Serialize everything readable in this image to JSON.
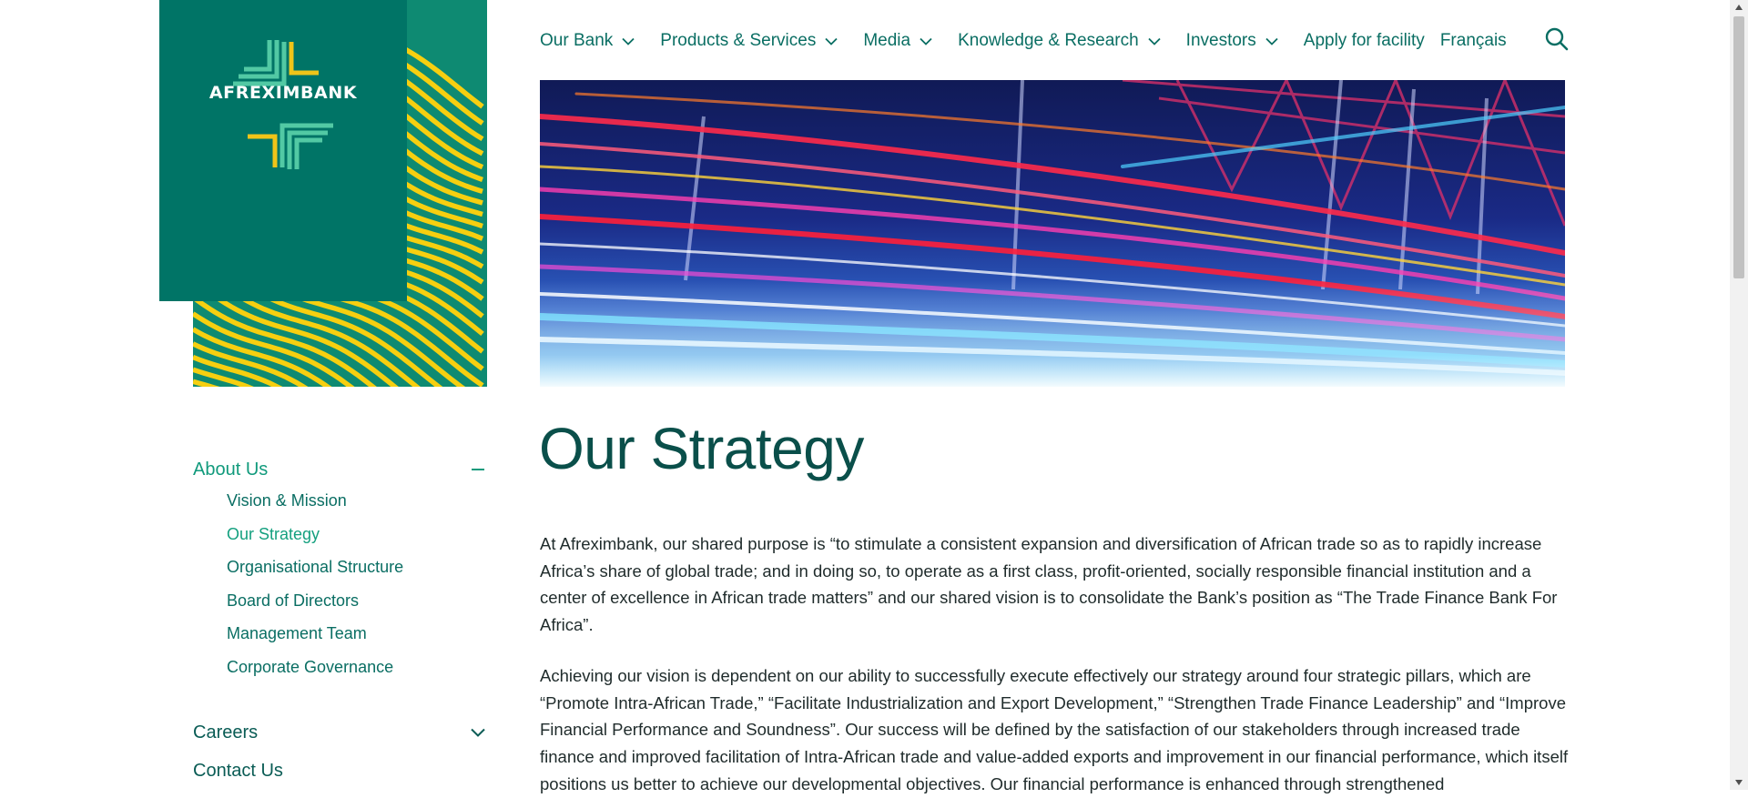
{
  "brand": {
    "name": "AFREXIMBANK",
    "colors": {
      "teal": "#007466",
      "stripe_green": "#0e8a72",
      "stripe_yellow": "#f6cf10",
      "logo_light": "#52c9a4",
      "logo_yellow": "#f0c419"
    }
  },
  "nav": {
    "items": [
      {
        "label": "Our Bank",
        "has_dropdown": true
      },
      {
        "label": "Products & Services",
        "has_dropdown": true
      },
      {
        "label": "Media",
        "has_dropdown": true
      },
      {
        "label": "Knowledge & Research",
        "has_dropdown": true
      },
      {
        "label": "Investors",
        "has_dropdown": true
      },
      {
        "label": "Apply for facility",
        "has_dropdown": false
      },
      {
        "label": "Français",
        "has_dropdown": false
      }
    ],
    "search_icon": "search-icon"
  },
  "sidebar": {
    "about": {
      "label": "About Us",
      "expanded": true,
      "links": [
        {
          "label": "Vision & Mission",
          "active": false
        },
        {
          "label": "Our Strategy",
          "active": true
        },
        {
          "label": "Organisational Structure",
          "active": false
        },
        {
          "label": "Board of Directors",
          "active": false
        },
        {
          "label": "Management Team",
          "active": false
        },
        {
          "label": "Corporate Governance",
          "active": false
        }
      ]
    },
    "careers": {
      "label": "Careers",
      "expanded": false
    },
    "contact": {
      "label": "Contact Us"
    }
  },
  "main": {
    "title": "Our Strategy",
    "paragraphs": [
      "At Afreximbank, our shared purpose is “to stimulate a consistent expansion and diversification of African trade so as to rapidly increase Africa’s share of global trade; and in doing so, to operate as a first class, profit-oriented, socially responsible financial institution and a center of excellence in African trade matters” and our shared vision is to consolidate the Bank’s position as “The Trade Finance Bank For Africa”.",
      "Achieving our vision is dependent on our ability to successfully execute effectively our strategy around four strategic pillars, which are “Promote Intra-African Trade,” “Facilitate Industrialization and Export Development,” “Strengthen Trade Finance Leadership” and “Improve Financial Performance and Soundness”. Our success will be defined by the satisfaction of our stakeholders through increased trade finance and improved facilitation of Intra-African trade and value-added exports and improvement in our financial performance, which itself positions us better to achieve our developmental objectives. Our financial performance is enhanced through strengthened"
    ]
  }
}
